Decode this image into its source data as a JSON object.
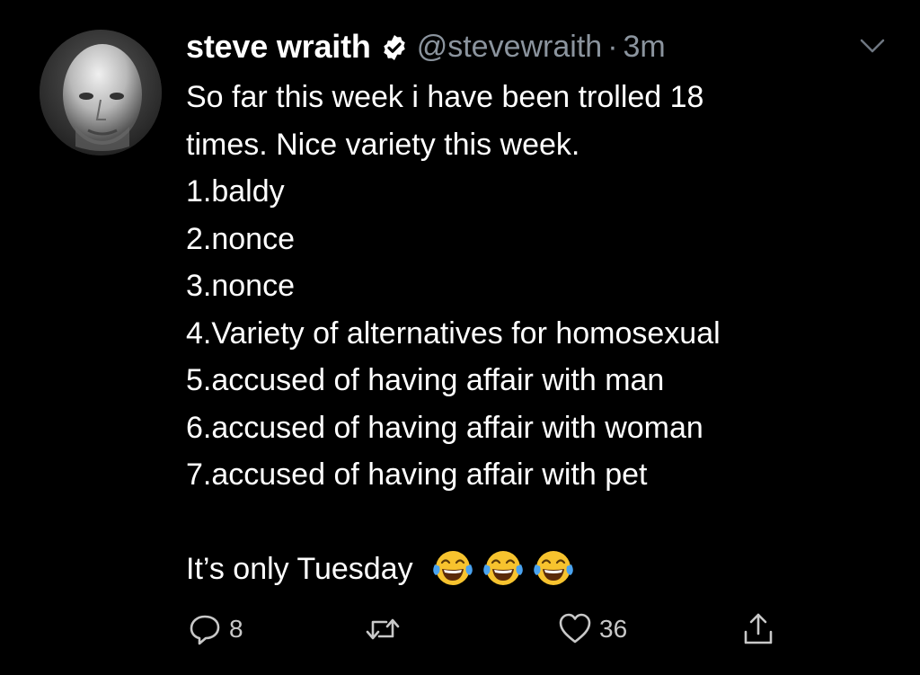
{
  "tweet": {
    "display_name": "steve wraith",
    "handle": "@stevewraith",
    "separator": "·",
    "time": "3m",
    "lines": [
      "So far this week i have been trolled 18",
      "times. Nice variety this week.",
      "1.baldy",
      "2.nonce",
      "3.nonce",
      "4.Variety of alternatives for homosexual",
      "5.accused of having affair with man",
      "6.accused of having affair with woman",
      "7.accused of having affair with pet"
    ],
    "closing_line": "It’s only Tuesday",
    "emoji_icon": "face-with-tears-of-joy-icon"
  },
  "actions": {
    "reply_count": "8",
    "retweet_count": "",
    "like_count": "36"
  },
  "colors": {
    "background": "#000000",
    "text": "#ffffff",
    "secondary": "#8b949e",
    "icon": "#c8c8c8",
    "verified_badge": "#ffffff"
  }
}
